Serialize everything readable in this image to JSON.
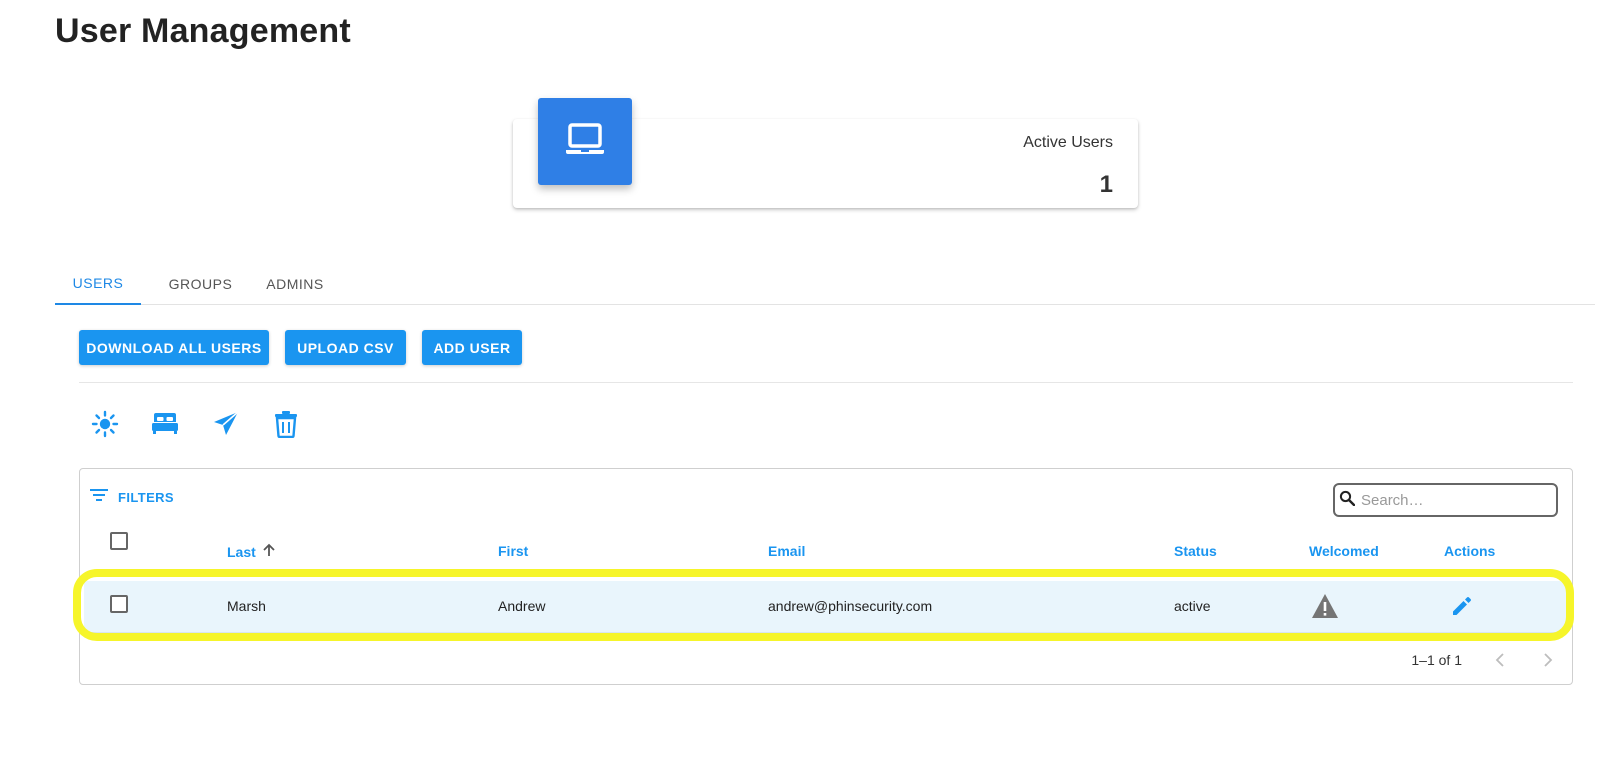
{
  "page": {
    "title": "User Management"
  },
  "stats": {
    "label": "Active Users",
    "value": "1",
    "icon": "laptop-icon"
  },
  "tabs": [
    {
      "label": "USERS",
      "active": true
    },
    {
      "label": "GROUPS",
      "active": false
    },
    {
      "label": "ADMINS",
      "active": false
    }
  ],
  "actions": {
    "download_label": "DOWNLOAD ALL USERS",
    "upload_label": "UPLOAD CSV",
    "add_label": "ADD USER"
  },
  "toolbar_icons": [
    "sun-icon",
    "bed-icon",
    "send-icon",
    "trash-icon"
  ],
  "grid": {
    "filters_label": "FILTERS",
    "search_placeholder": "Search…",
    "columns": {
      "last": "Last",
      "first": "First",
      "email": "Email",
      "status": "Status",
      "welcomed": "Welcomed",
      "actions": "Actions"
    },
    "rows": [
      {
        "last": "Marsh",
        "first": "Andrew",
        "email": "andrew@phinsecurity.com",
        "status": "active",
        "welcomed_icon": "warning-icon",
        "action_icon": "edit-icon"
      }
    ],
    "pagination": "1–1 of 1"
  },
  "colors": {
    "primary": "#1a95f0",
    "card_icon_bg": "#2f7fe6",
    "row_bg": "#e9f5fc",
    "highlight": "#f6f52a"
  }
}
